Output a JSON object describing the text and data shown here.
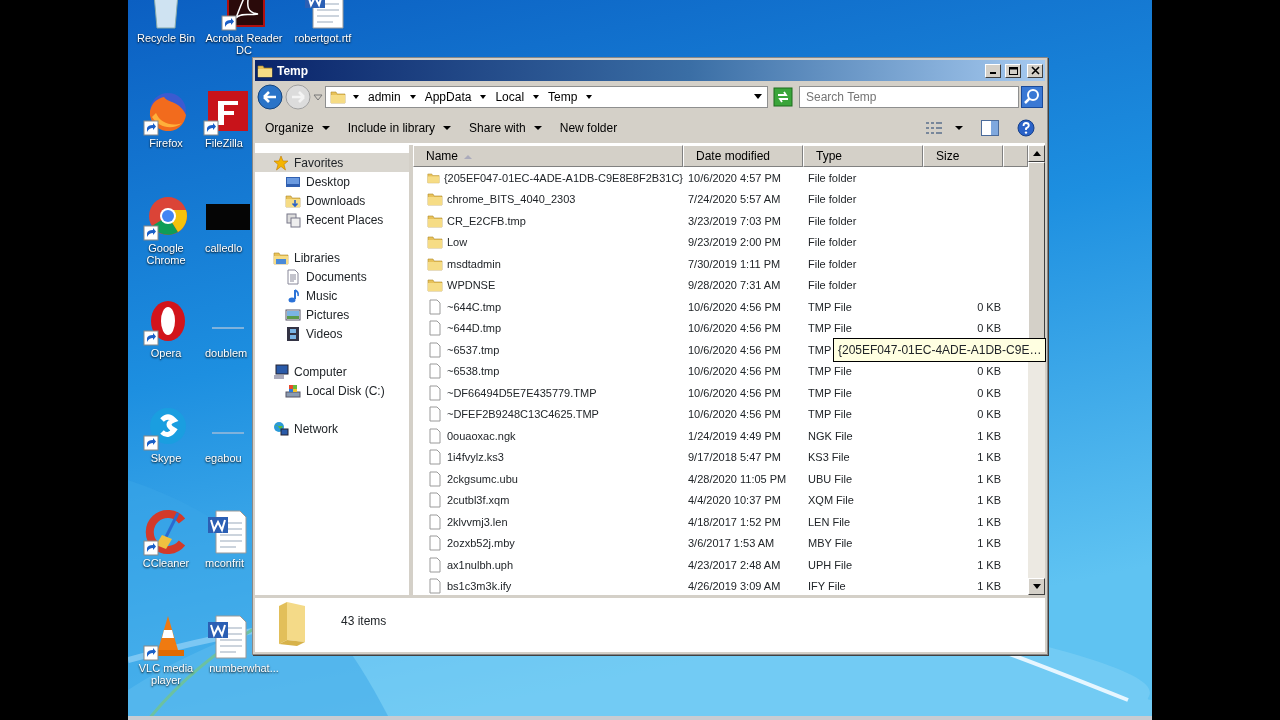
{
  "desktop": {
    "columns": [
      [
        {
          "label": "Recycle Bin",
          "kind": "trash",
          "shortcut": false
        },
        {
          "label": "Firefox",
          "kind": "fox",
          "shortcut": true
        },
        {
          "label": "Google Chrome",
          "kind": "chrome",
          "shortcut": true
        },
        {
          "label": "Opera",
          "kind": "opera",
          "shortcut": true
        },
        {
          "label": "Skype",
          "kind": "chat",
          "shortcut": true
        },
        {
          "label": "CCleaner",
          "kind": "broom",
          "shortcut": true
        },
        {
          "label": "VLC media player",
          "kind": "cone",
          "shortcut": true
        }
      ],
      [
        {
          "label": "Acrobat Reader DC",
          "kind": "pdf",
          "shortcut": true
        },
        {
          "label": "FileZilla",
          "kind": "ftp",
          "shortcut": true
        },
        {
          "label": "calledlo",
          "kind": "dark",
          "shortcut": false
        },
        {
          "label": "doublem",
          "kind": "blank",
          "shortcut": false
        },
        {
          "label": "egabou",
          "kind": "blank",
          "shortcut": false
        },
        {
          "label": "mconfrit",
          "kind": "word",
          "shortcut": false
        },
        {
          "label": "numberwhat...",
          "kind": "word",
          "shortcut": false
        }
      ],
      [
        {
          "label": "robertgot.rtf",
          "kind": "word",
          "shortcut": false
        }
      ]
    ]
  },
  "window": {
    "title": "Temp",
    "breadcrumb": [
      "admin",
      "AppData",
      "Local",
      "Temp"
    ],
    "search": {
      "placeholder": "Search Temp"
    },
    "toolbar": [
      {
        "label": "Organize",
        "dropdown": true
      },
      {
        "label": "Include in library",
        "dropdown": true
      },
      {
        "label": "Share with",
        "dropdown": true
      },
      {
        "label": "New folder",
        "dropdown": false
      }
    ],
    "nav": [
      {
        "label": "Favorites",
        "kind": "star",
        "selected": true,
        "children": [
          {
            "label": "Desktop",
            "kind": "desktop",
            "selected": false
          },
          {
            "label": "Downloads",
            "kind": "downloads",
            "selected": false
          },
          {
            "label": "Recent Places",
            "kind": "recent",
            "selected": false
          }
        ]
      },
      {
        "label": "Libraries",
        "kind": "library",
        "selected": false,
        "children": [
          {
            "label": "Documents",
            "kind": "documents",
            "selected": false
          },
          {
            "label": "Music",
            "kind": "music",
            "selected": false
          },
          {
            "label": "Pictures",
            "kind": "pictures",
            "selected": false
          },
          {
            "label": "Videos",
            "kind": "videos",
            "selected": false
          }
        ]
      },
      {
        "label": "Computer",
        "kind": "computer",
        "selected": false,
        "children": [
          {
            "label": "Local Disk (C:)",
            "kind": "disk",
            "selected": false
          }
        ]
      },
      {
        "label": "Network",
        "kind": "network",
        "selected": false
      }
    ],
    "table": {
      "columns": [
        {
          "label": "Name",
          "sorted": true
        },
        {
          "label": "Date modified",
          "sorted": false
        },
        {
          "label": "Type",
          "sorted": false
        },
        {
          "label": "Size",
          "sorted": false
        }
      ],
      "rows": [
        {
          "kind": "folder",
          "name": "{205EF047-01EC-4ADE-A1DB-C9E8E8F2B31C}",
          "date": "10/6/2020 4:57 PM",
          "type": "File folder"
        },
        {
          "kind": "folder",
          "name": "chrome_BITS_4040_2303",
          "date": "7/24/2020 5:57 AM",
          "type": "File folder"
        },
        {
          "kind": "folder",
          "name": "CR_E2CFB.tmp",
          "date": "3/23/2019 7:03 PM",
          "type": "File folder"
        },
        {
          "kind": "folder",
          "name": "Low",
          "date": "9/23/2019 2:00 PM",
          "type": "File folder"
        },
        {
          "kind": "folder",
          "name": "msdtadmin",
          "date": "7/30/2019 1:11 PM",
          "type": "File folder"
        },
        {
          "kind": "folder",
          "name": "WPDNSE",
          "date": "9/28/2020 7:31 AM",
          "type": "File folder"
        },
        {
          "kind": "file",
          "name": "~644C.tmp",
          "date": "10/6/2020 4:56 PM",
          "type": "TMP File",
          "size": "0 KB"
        },
        {
          "kind": "file",
          "name": "~644D.tmp",
          "date": "10/6/2020 4:56 PM",
          "type": "TMP File",
          "size": "0 KB"
        },
        {
          "kind": "file",
          "name": "~6537.tmp",
          "date": "10/6/2020 4:56 PM",
          "type": "TMP"
        },
        {
          "kind": "file",
          "name": "~6538.tmp",
          "date": "10/6/2020 4:56 PM",
          "type": "TMP File",
          "size": "0 KB"
        },
        {
          "kind": "file",
          "name": "~DF66494D5E7E435779.TMP",
          "date": "10/6/2020 4:56 PM",
          "type": "TMP File",
          "size": "0 KB"
        },
        {
          "kind": "file",
          "name": "~DFEF2B9248C13C4625.TMP",
          "date": "10/6/2020 4:56 PM",
          "type": "TMP File",
          "size": "0 KB"
        },
        {
          "kind": "file",
          "name": "0ouaoxac.ngk",
          "date": "1/24/2019 4:49 PM",
          "type": "NGK File",
          "size": "1 KB"
        },
        {
          "kind": "file",
          "name": "1i4fvylz.ks3",
          "date": "9/17/2018 5:47 PM",
          "type": "KS3 File",
          "size": "1 KB"
        },
        {
          "kind": "file",
          "name": "2ckgsumc.ubu",
          "date": "4/28/2020 11:05 PM",
          "type": "UBU File",
          "size": "1 KB"
        },
        {
          "kind": "file",
          "name": "2cutbl3f.xqm",
          "date": "4/4/2020 10:37 PM",
          "type": "XQM File",
          "size": "1 KB"
        },
        {
          "kind": "file",
          "name": "2klvvmj3.len",
          "date": "4/18/2017 1:52 PM",
          "type": "LEN File",
          "size": "1 KB"
        },
        {
          "kind": "file",
          "name": "2ozxb52j.mby",
          "date": "3/6/2017 1:53 AM",
          "type": "MBY File",
          "size": "1 KB"
        },
        {
          "kind": "file",
          "name": "ax1nulbh.uph",
          "date": "4/23/2017 2:48 AM",
          "type": "UPH File",
          "size": "1 KB"
        },
        {
          "kind": "file",
          "name": "bs1c3m3k.ify",
          "date": "4/26/2019 3:09 AM",
          "type": "IFY File",
          "size": "1 KB"
        }
      ]
    },
    "tooltip": "{205EF047-01EC-4ADE-A1DB-C9E…",
    "details": {
      "count": "43 items"
    }
  }
}
